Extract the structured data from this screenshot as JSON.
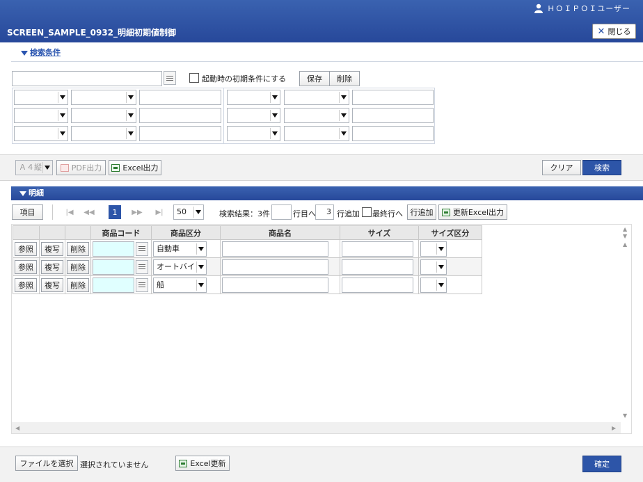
{
  "header": {
    "user_name": "ＨＯＩＰＯＩユーザー",
    "title": "SCREEN_SAMPLE_0932_明細初期値制御",
    "close_label": "閉じる"
  },
  "conditions": {
    "section_label": "検索条件",
    "startup_label": "起動時の初期条件にする",
    "save_label": "保存",
    "delete_label": "削除"
  },
  "toolbar": {
    "paper_value": "Ａ４縦",
    "pdf_label": "PDF出力",
    "excel_label": "Excel出力",
    "clear_label": "クリア",
    "search_label": "検索"
  },
  "detail": {
    "section_label": "明細",
    "items_label": "項目",
    "current_page": "1",
    "page_size": "50",
    "result_text": "検索結果：3件",
    "row_goto_label": "行目へ",
    "add_count": "3",
    "add_rows_label": "行追加",
    "last_row_label": "最終行へ",
    "add_row_label": "行追加",
    "excel_update_label": "更新Excel出力",
    "columns": [
      "商品コード",
      "商品区分",
      "商品名",
      "サイズ",
      "サイズ区分"
    ],
    "row_buttons": {
      "ref": "参照",
      "copy": "複写",
      "del": "削除"
    },
    "rows": [
      {
        "code": "",
        "category": "自動車",
        "name": "",
        "size": "",
        "size_type": ""
      },
      {
        "code": "",
        "category": "オートバイ",
        "name": "",
        "size": "",
        "size_type": ""
      },
      {
        "code": "",
        "category": "船",
        "name": "",
        "size": "",
        "size_type": ""
      }
    ]
  },
  "footer": {
    "file_button": "ファイルを選択",
    "file_status": "選択されていません",
    "excel_update": "Excel更新",
    "confirm": "確定"
  },
  "colors": {
    "brand_blue": "#2d55a8",
    "code_cell": "#e0ffff"
  }
}
